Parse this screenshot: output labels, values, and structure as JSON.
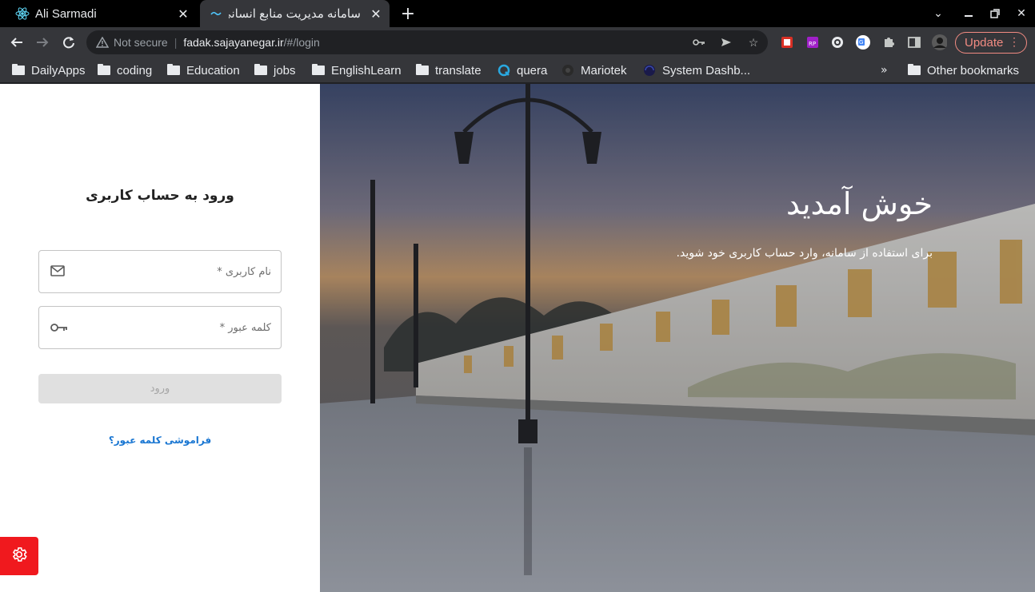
{
  "browser": {
    "tabs": [
      {
        "title": "Ali Sarmadi",
        "active": false
      },
      {
        "title": "سامانه مدیریت منابع انسانی",
        "active": true
      }
    ],
    "omnibox": {
      "security": "Not secure",
      "url_host": "fadak.sajayanegar.ir",
      "url_path": "/#/login"
    },
    "update_label": "Update",
    "bookmarks": [
      {
        "label": "DailyApps",
        "icon": "folder-icon"
      },
      {
        "label": "coding",
        "icon": "folder-icon"
      },
      {
        "label": "Education",
        "icon": "folder-icon"
      },
      {
        "label": "jobs",
        "icon": "folder-icon"
      },
      {
        "label": "EnglishLearn",
        "icon": "folder-icon"
      },
      {
        "label": "translate",
        "icon": "folder-icon"
      },
      {
        "label": "quera",
        "icon": "quera-icon"
      },
      {
        "label": "Mariotek",
        "icon": "mariotek-icon"
      },
      {
        "label": "System Dashb...",
        "icon": "dashboard-icon"
      }
    ],
    "other_bookmarks": "Other bookmarks"
  },
  "login": {
    "title": "ورود به حساب کاربری",
    "username_placeholder": "نام کاربری *",
    "password_placeholder": "کلمه عبور *",
    "submit_label": "ورود",
    "forgot_label": "فراموشی کلمه عبور؟"
  },
  "hero": {
    "welcome": "خوش آمدید",
    "subtitle": "برای استفاده از سامانه، وارد حساب کاربری خود شوید."
  },
  "colors": {
    "accent_link": "#1976d2",
    "fab_red": "#f0191e",
    "button_disabled": "#e0e0e0"
  }
}
